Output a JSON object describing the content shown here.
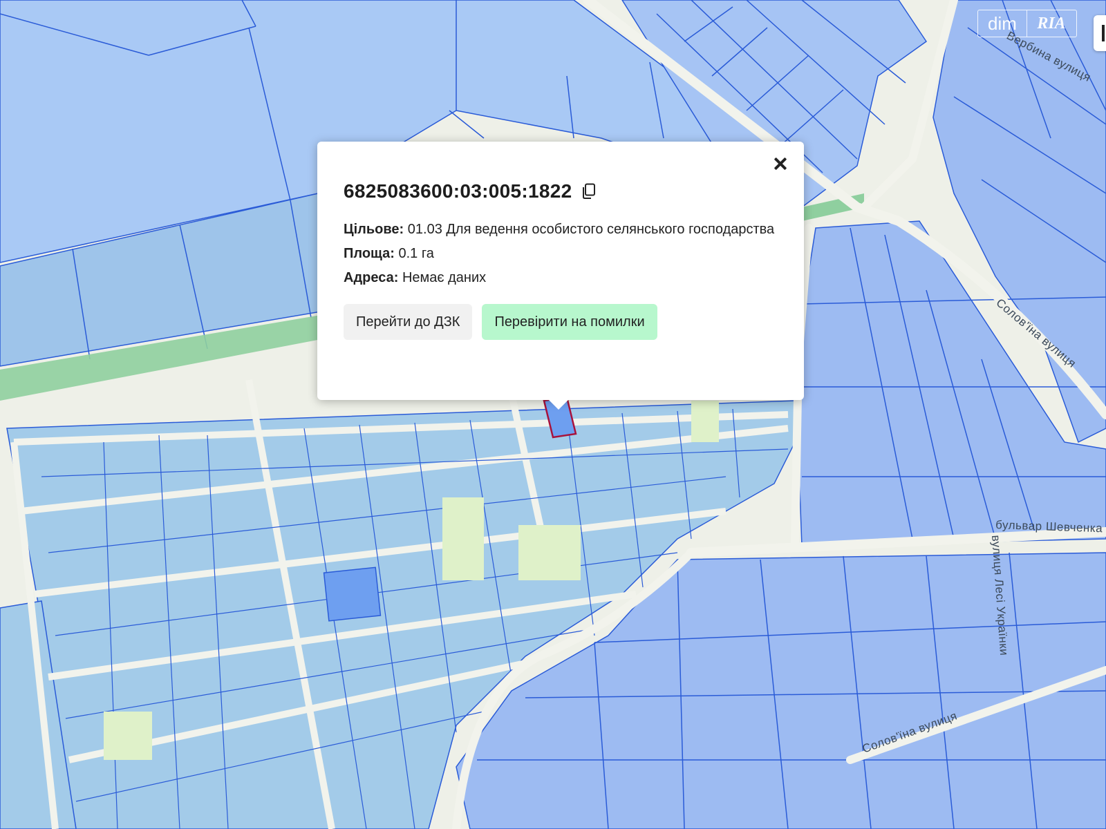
{
  "map": {
    "streets": [
      "Вербина вулиця",
      "Солов'їна вулиця",
      "бульвар Шевченка",
      "вулиця Лесі Українки",
      "Солов'їна вулиця"
    ],
    "colors": {
      "parcel": "#a6c4f4",
      "parcel_border": "#2a5bd7",
      "road": "#f2f3ec",
      "green": "#c7e6a8",
      "selected": "#6e9ff0"
    }
  },
  "watermark": {
    "left": "dim",
    "right": "RIA"
  },
  "popup": {
    "cadastral_number": "6825083600:03:005:1822",
    "purpose_label": "Цільове:",
    "purpose_value": "01.03 Для ведення особистого селянського господарства",
    "area_label": "Площа:",
    "area_value": "0.1 га",
    "address_label": "Адреса:",
    "address_value": "Немає даних",
    "btn_dzk": "Перейти до ДЗК",
    "btn_check": "Перевірити на помилки"
  }
}
